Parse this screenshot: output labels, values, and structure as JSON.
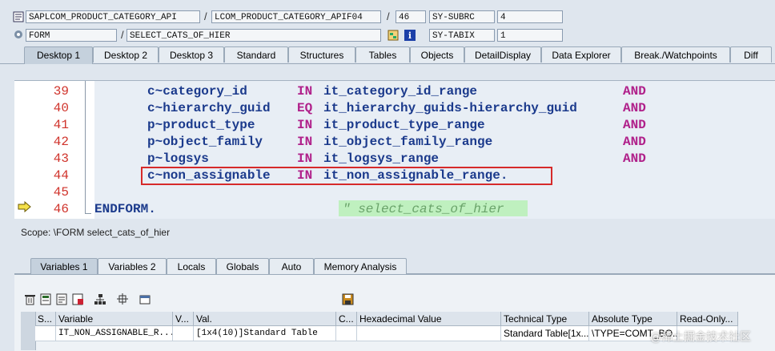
{
  "header": {
    "program": "SAPLCOM_PRODUCT_CATEGORY_API",
    "include": "LCOM_PRODUCT_CATEGORY_APIF04",
    "line": "46",
    "sy_subrc_label": "SY-SUBRC",
    "sy_subrc_value": "4",
    "event_type": "FORM",
    "event_name": "SELECT_CATS_OF_HIER",
    "sy_tabix_label": "SY-TABIX",
    "sy_tabix_value": "1"
  },
  "main_tabs": [
    {
      "label": "Desktop 1",
      "active": true
    },
    {
      "label": "Desktop 2"
    },
    {
      "label": "Desktop 3"
    },
    {
      "label": "Standard"
    },
    {
      "label": "Structures"
    },
    {
      "label": "Tables"
    },
    {
      "label": "Objects"
    },
    {
      "label": "DetailDisplay"
    },
    {
      "label": "Data Explorer"
    },
    {
      "label": "Break./Watchpoints"
    },
    {
      "label": "Diff"
    }
  ],
  "code": {
    "lines": [
      {
        "no": "39",
        "a": "c~category_id",
        "op": "IN",
        "b": "it_category_id_range",
        "end": "AND"
      },
      {
        "no": "40",
        "a": "c~hierarchy_guid",
        "op": "EQ",
        "b": "it_hierarchy_guids-hierarchy_guid",
        "end": "AND"
      },
      {
        "no": "41",
        "a": "p~product_type",
        "op": "IN",
        "b": "it_product_type_range",
        "end": "AND"
      },
      {
        "no": "42",
        "a": "p~object_family",
        "op": "IN",
        "b": "it_object_family_range",
        "end": "AND"
      },
      {
        "no": "43",
        "a": "p~logsys",
        "op": "IN",
        "b": "it_logsys_range",
        "end": "AND"
      },
      {
        "no": "44",
        "a": "c~non_assignable",
        "op": "IN",
        "b": "it_non_assignable_range.",
        "end": ""
      },
      {
        "no": "45",
        "a": "",
        "op": "",
        "b": "",
        "end": ""
      },
      {
        "no": "46",
        "a": "ENDFORM.",
        "op": "",
        "b": "",
        "end": ""
      }
    ],
    "comment": "\" select_cats_of_hier"
  },
  "scope": "Scope: \\FORM select_cats_of_hier",
  "var_tabs": [
    {
      "label": "Variables 1",
      "active": true
    },
    {
      "label": "Variables 2"
    },
    {
      "label": "Locals"
    },
    {
      "label": "Globals"
    },
    {
      "label": "Auto"
    },
    {
      "label": "Memory Analysis"
    }
  ],
  "grid": {
    "headers": [
      "S...",
      "Variable",
      "V...",
      "Val.",
      "C...",
      "Hexadecimal Value",
      "Technical Type",
      "Absolute Type",
      "Read-Only..."
    ],
    "row": [
      "",
      "IT_NON_ASSIGNABLE_R...",
      "",
      "[1x4(10)]Standard Table",
      "",
      "",
      "Standard Table[1x...",
      "\\TYPE=COMT_BO...",
      ""
    ]
  },
  "watermark": "@稀土掘金技术社区",
  "colors": {
    "keyword": "#b0208a",
    "identifier": "#1b3a8c",
    "line_number": "#d0342c",
    "highlight_box": "#d62a2a",
    "comment": "#7fb07f"
  }
}
